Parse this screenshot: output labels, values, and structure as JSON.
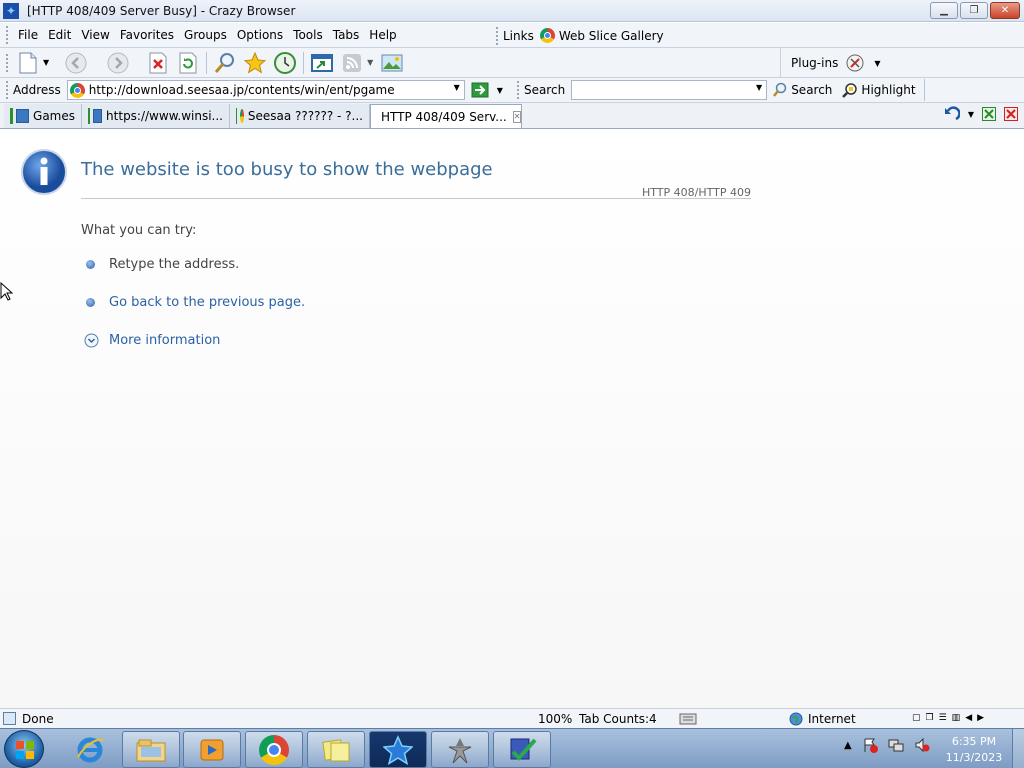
{
  "window": {
    "title": "[HTTP 408/409 Server Busy] - Crazy Browser"
  },
  "menu": {
    "items": [
      "File",
      "Edit",
      "View",
      "Favorites",
      "Groups",
      "Options",
      "Tools",
      "Tabs",
      "Help"
    ],
    "links_label": "Links",
    "web_slice_label": "Web Slice Gallery"
  },
  "toolbar": {
    "plugins_label": "Plug-ins"
  },
  "address": {
    "label": "Address",
    "url": "http://download.seesaa.jp/contents/win/ent/pgame",
    "search_label": "Search",
    "search_value": "",
    "search_button": "Search",
    "highlight_button": "Highlight"
  },
  "tabs": [
    {
      "label": "Games",
      "active": false
    },
    {
      "label": "https://www.winsi...",
      "active": false
    },
    {
      "label": "Seesaa ?????? - ?...",
      "active": false
    },
    {
      "label": "HTTP 408/409 Serv...",
      "active": true
    }
  ],
  "page": {
    "heading": "The website is too busy to show the webpage",
    "error_code": "HTTP 408/HTTP 409",
    "try_label": "What you can try:",
    "suggestions": [
      "Retype the address.",
      "Go back to the previous page."
    ],
    "more_info": "More information"
  },
  "status": {
    "text": "Done",
    "zoom": "100%",
    "tab_counts": "Tab Counts:4",
    "zone": "Internet"
  },
  "clock": {
    "time": "6:35 PM",
    "date": "11/3/2023"
  },
  "colors": {
    "accent": "#1f57a4",
    "link": "#2b62a6",
    "heading": "#3a6d99"
  }
}
